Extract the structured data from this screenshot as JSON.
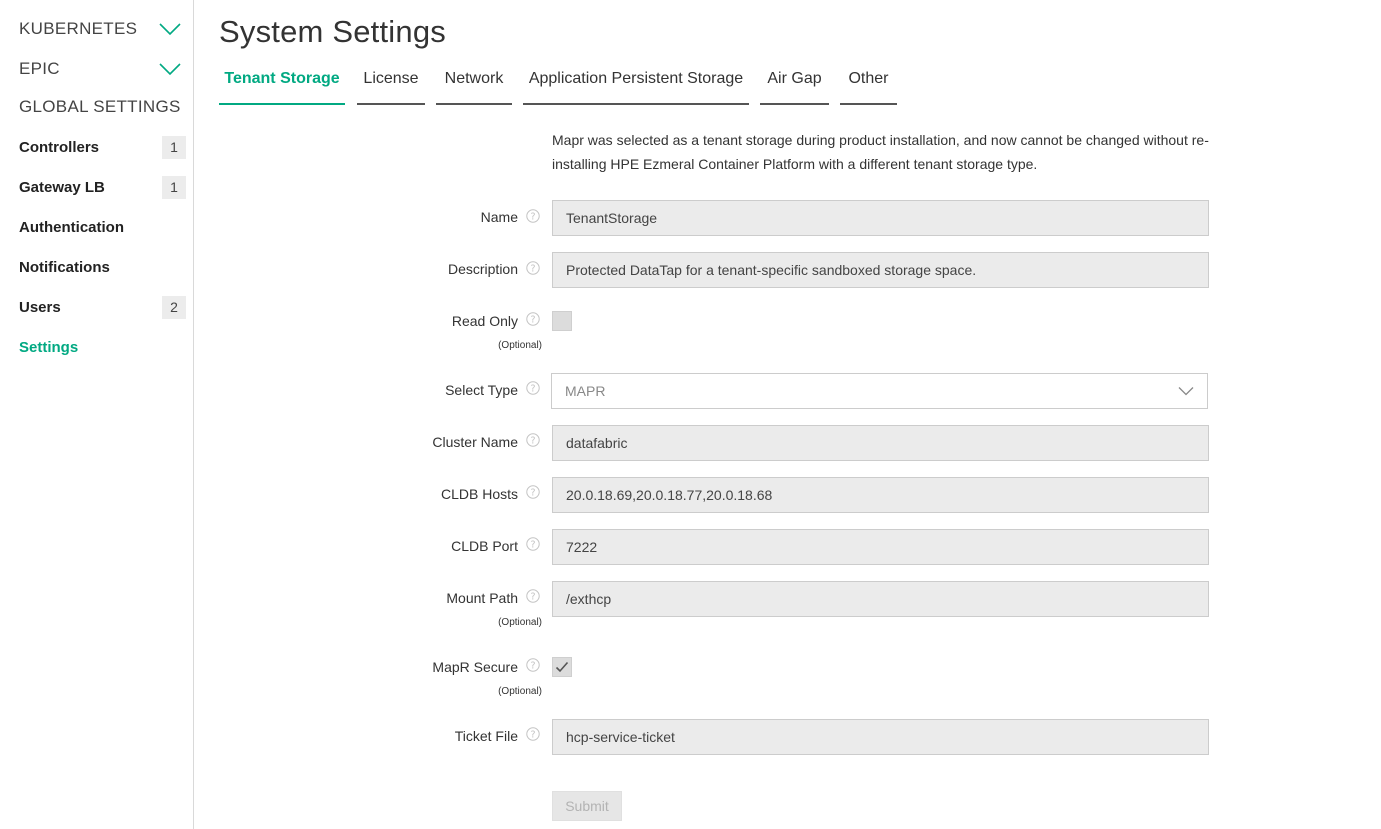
{
  "sidebar": {
    "groups": [
      {
        "label": "KUBERNETES",
        "icon": "chevron-down-icon"
      },
      {
        "label": "EPIC",
        "icon": "chevron-down-icon"
      }
    ],
    "heading": "GLOBAL SETTINGS",
    "items": [
      {
        "label": "Controllers",
        "badge": "1"
      },
      {
        "label": "Gateway LB",
        "badge": "1"
      },
      {
        "label": "Authentication",
        "badge": null
      },
      {
        "label": "Notifications",
        "badge": null
      },
      {
        "label": "Users",
        "badge": "2"
      },
      {
        "label": "Settings",
        "badge": null,
        "active": true
      }
    ]
  },
  "main": {
    "title": "System Settings",
    "tabs": [
      {
        "label": "Tenant Storage",
        "active": true
      },
      {
        "label": "License"
      },
      {
        "label": "Network"
      },
      {
        "label": "Application Persistent Storage"
      },
      {
        "label": "Air Gap"
      },
      {
        "label": "Other"
      }
    ],
    "intro_line1": "Mapr was selected as a tenant storage during product installation, and now cannot be changed without re-",
    "intro_line2": "installing HPE Ezmeral Container Platform with a different tenant storage type.",
    "optional_label": "(Optional)",
    "form": {
      "name": {
        "label": "Name",
        "value": "TenantStorage"
      },
      "description": {
        "label": "Description",
        "value": "Protected DataTap for a tenant-specific sandboxed storage space."
      },
      "read_only": {
        "label": "Read Only",
        "checked": false
      },
      "select_type": {
        "label": "Select Type",
        "value": "MAPR"
      },
      "cluster_name": {
        "label": "Cluster Name",
        "value": "datafabric"
      },
      "cldb_hosts": {
        "label": "CLDB Hosts",
        "value": "20.0.18.69,20.0.18.77,20.0.18.68"
      },
      "cldb_port": {
        "label": "CLDB Port",
        "value": "7222"
      },
      "mount_path": {
        "label": "Mount Path",
        "value": "/exthcp"
      },
      "mapr_secure": {
        "label": "MapR Secure",
        "checked": true
      },
      "ticket_file": {
        "label": "Ticket File",
        "value": "hcp-service-ticket"
      }
    },
    "submit_label": "Submit"
  },
  "colors": {
    "accent": "#01a982",
    "input_bg": "#ebebeb",
    "text": "#333333"
  }
}
